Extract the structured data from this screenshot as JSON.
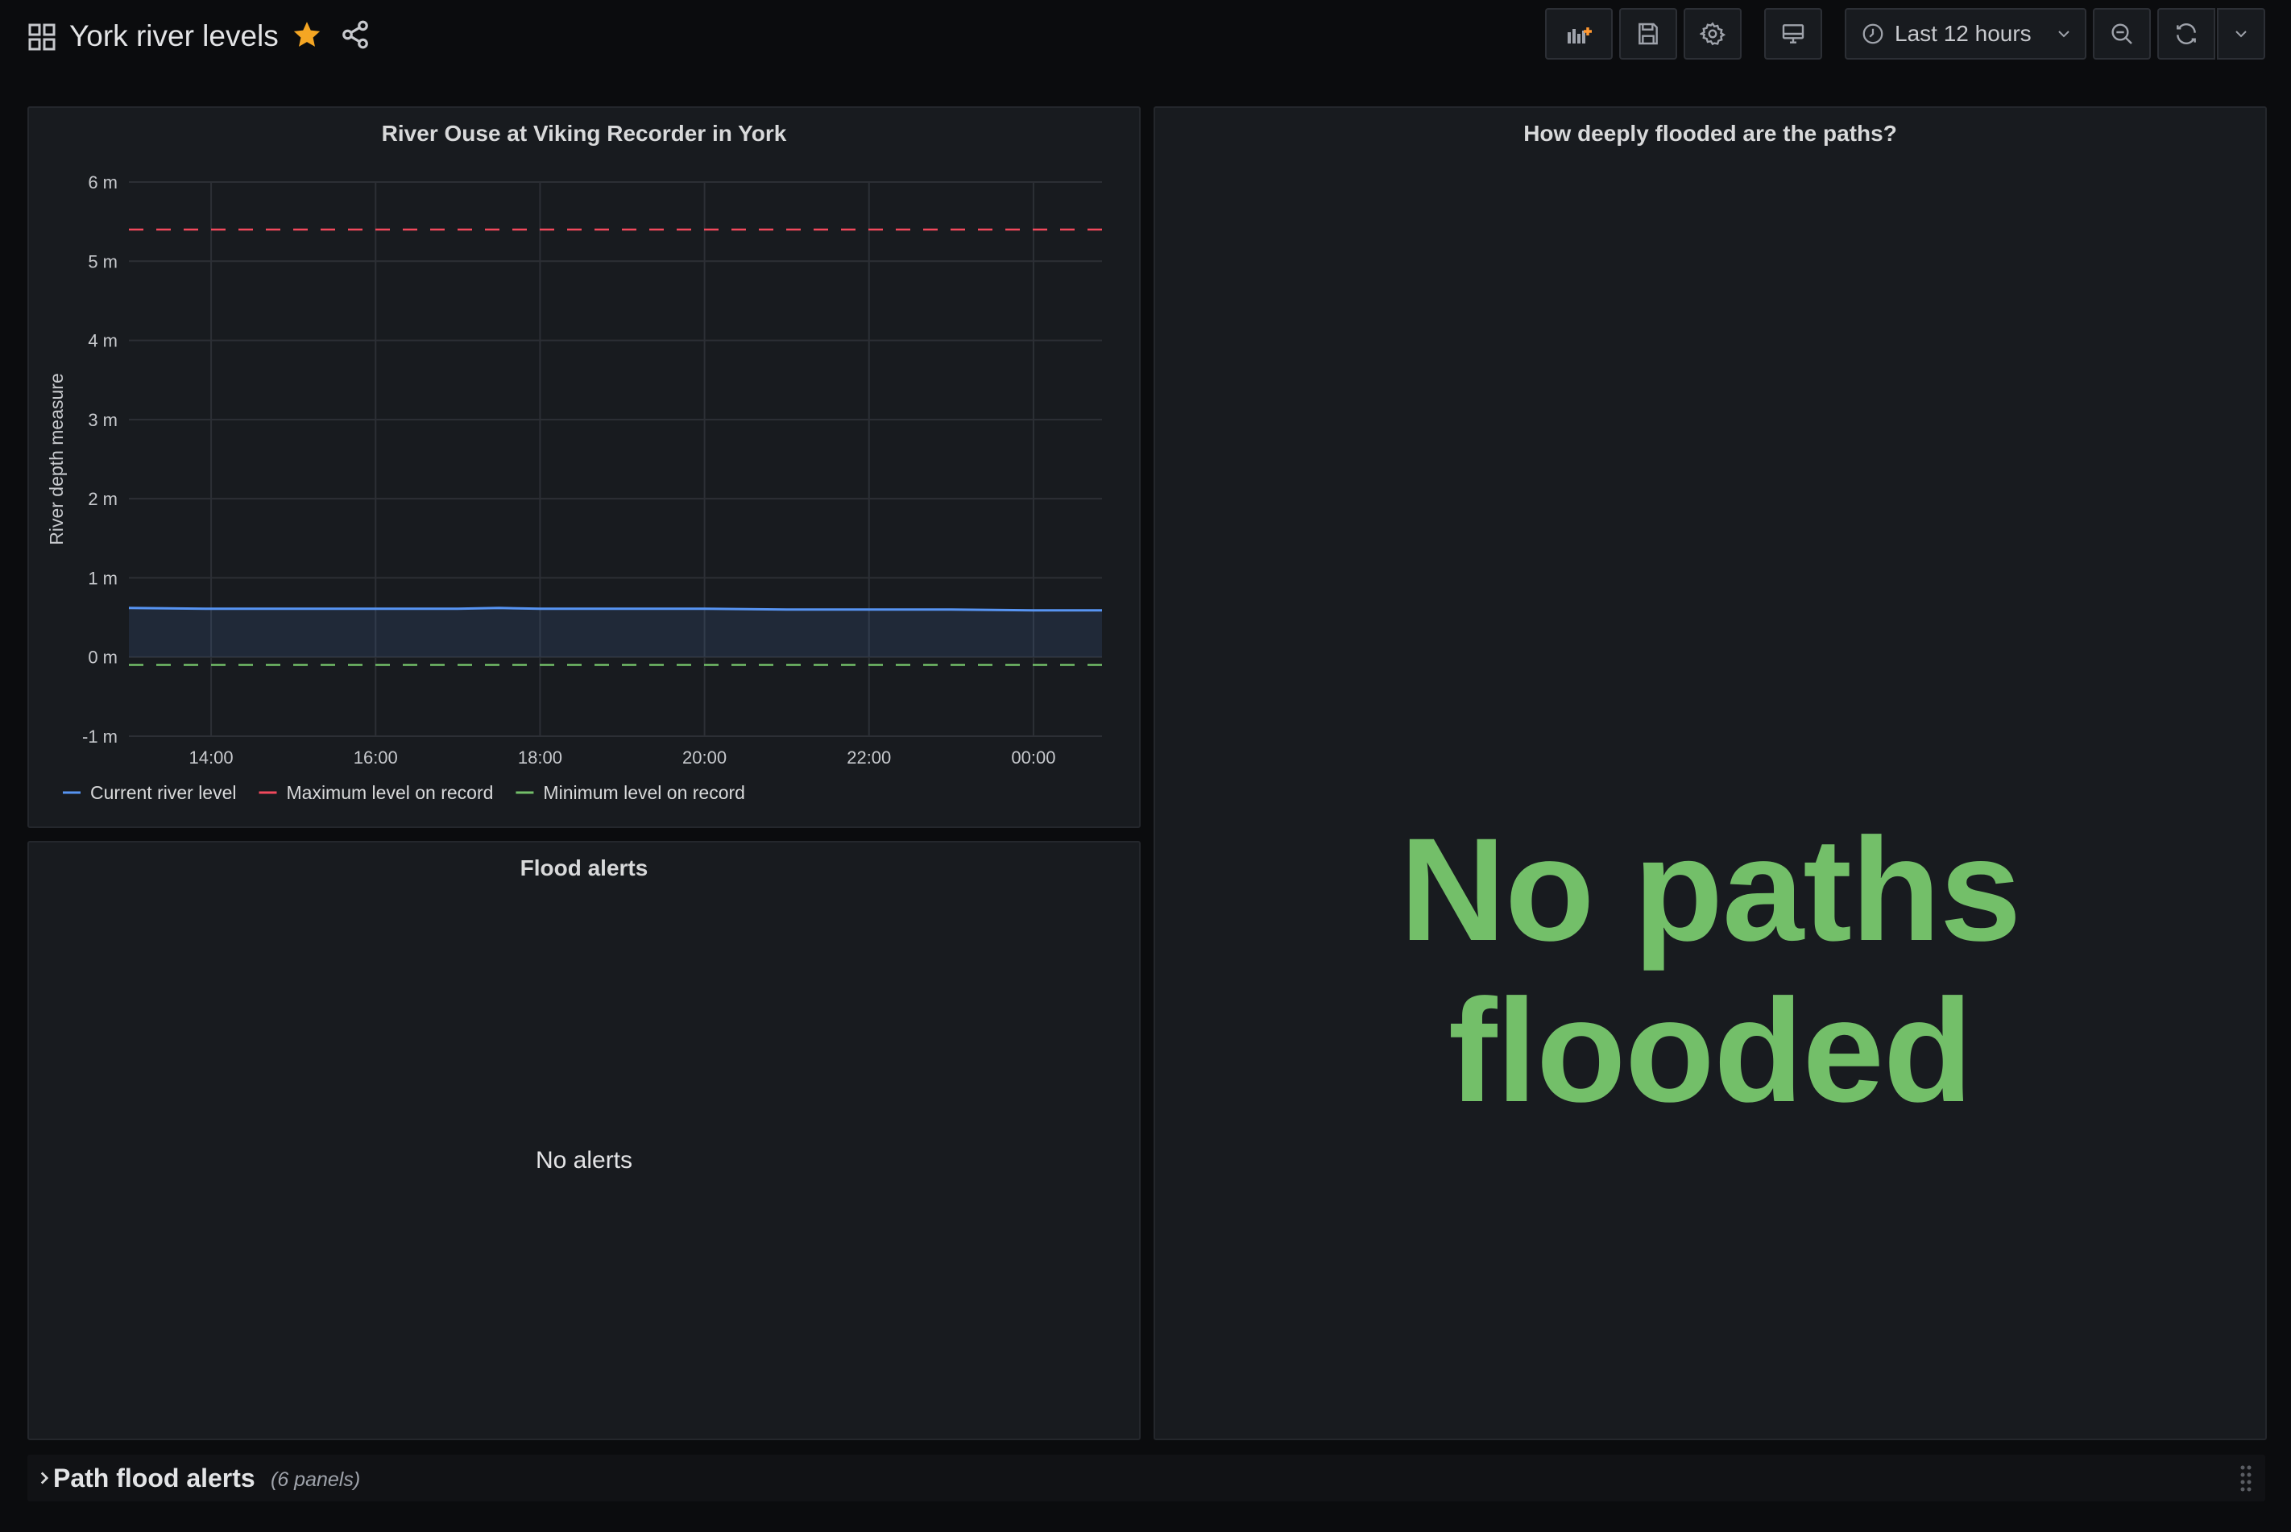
{
  "header": {
    "title": "York river levels",
    "time_range": "Last 12 hours"
  },
  "colors": {
    "current": "#5794f2",
    "maximum": "#f2495c",
    "minimum": "#73bf69",
    "star": "#f5a623",
    "stat": "#73bf69"
  },
  "river_panel": {
    "title": "River Ouse at Viking Recorder in York",
    "chart_data": {
      "type": "line",
      "ylabel": "River depth measure",
      "ylim": [
        -1,
        6
      ],
      "yticks": [
        "6 m",
        "5 m",
        "4 m",
        "3 m",
        "2 m",
        "1 m",
        "0 m",
        "-1 m"
      ],
      "xticks": [
        "14:00",
        "16:00",
        "18:00",
        "20:00",
        "22:00",
        "00:00"
      ],
      "grid": true,
      "legend_placement": "bottom-left",
      "series": [
        {
          "name": "Current river level",
          "style": "area",
          "x": [
            "13:00",
            "14:00",
            "15:00",
            "16:00",
            "17:00",
            "17:30",
            "18:00",
            "19:00",
            "20:00",
            "21:00",
            "22:00",
            "23:00",
            "00:00",
            "00:50"
          ],
          "values": [
            0.62,
            0.61,
            0.61,
            0.61,
            0.61,
            0.62,
            0.61,
            0.61,
            0.61,
            0.6,
            0.6,
            0.6,
            0.59,
            0.59
          ]
        },
        {
          "name": "Maximum level on record",
          "style": "dashed",
          "x": [
            "13:00",
            "00:50"
          ],
          "values": [
            5.4,
            5.4
          ]
        },
        {
          "name": "Minimum level on record",
          "style": "dashed",
          "x": [
            "13:00",
            "00:50"
          ],
          "values": [
            -0.1,
            -0.1
          ]
        }
      ]
    }
  },
  "flood_panel": {
    "title": "How deeply flooded are the paths?",
    "value": "No paths flooded"
  },
  "alerts_panel": {
    "title": "Flood alerts",
    "empty_text": "No alerts"
  },
  "row": {
    "title": "Path flood alerts",
    "count": "(6 panels)"
  }
}
